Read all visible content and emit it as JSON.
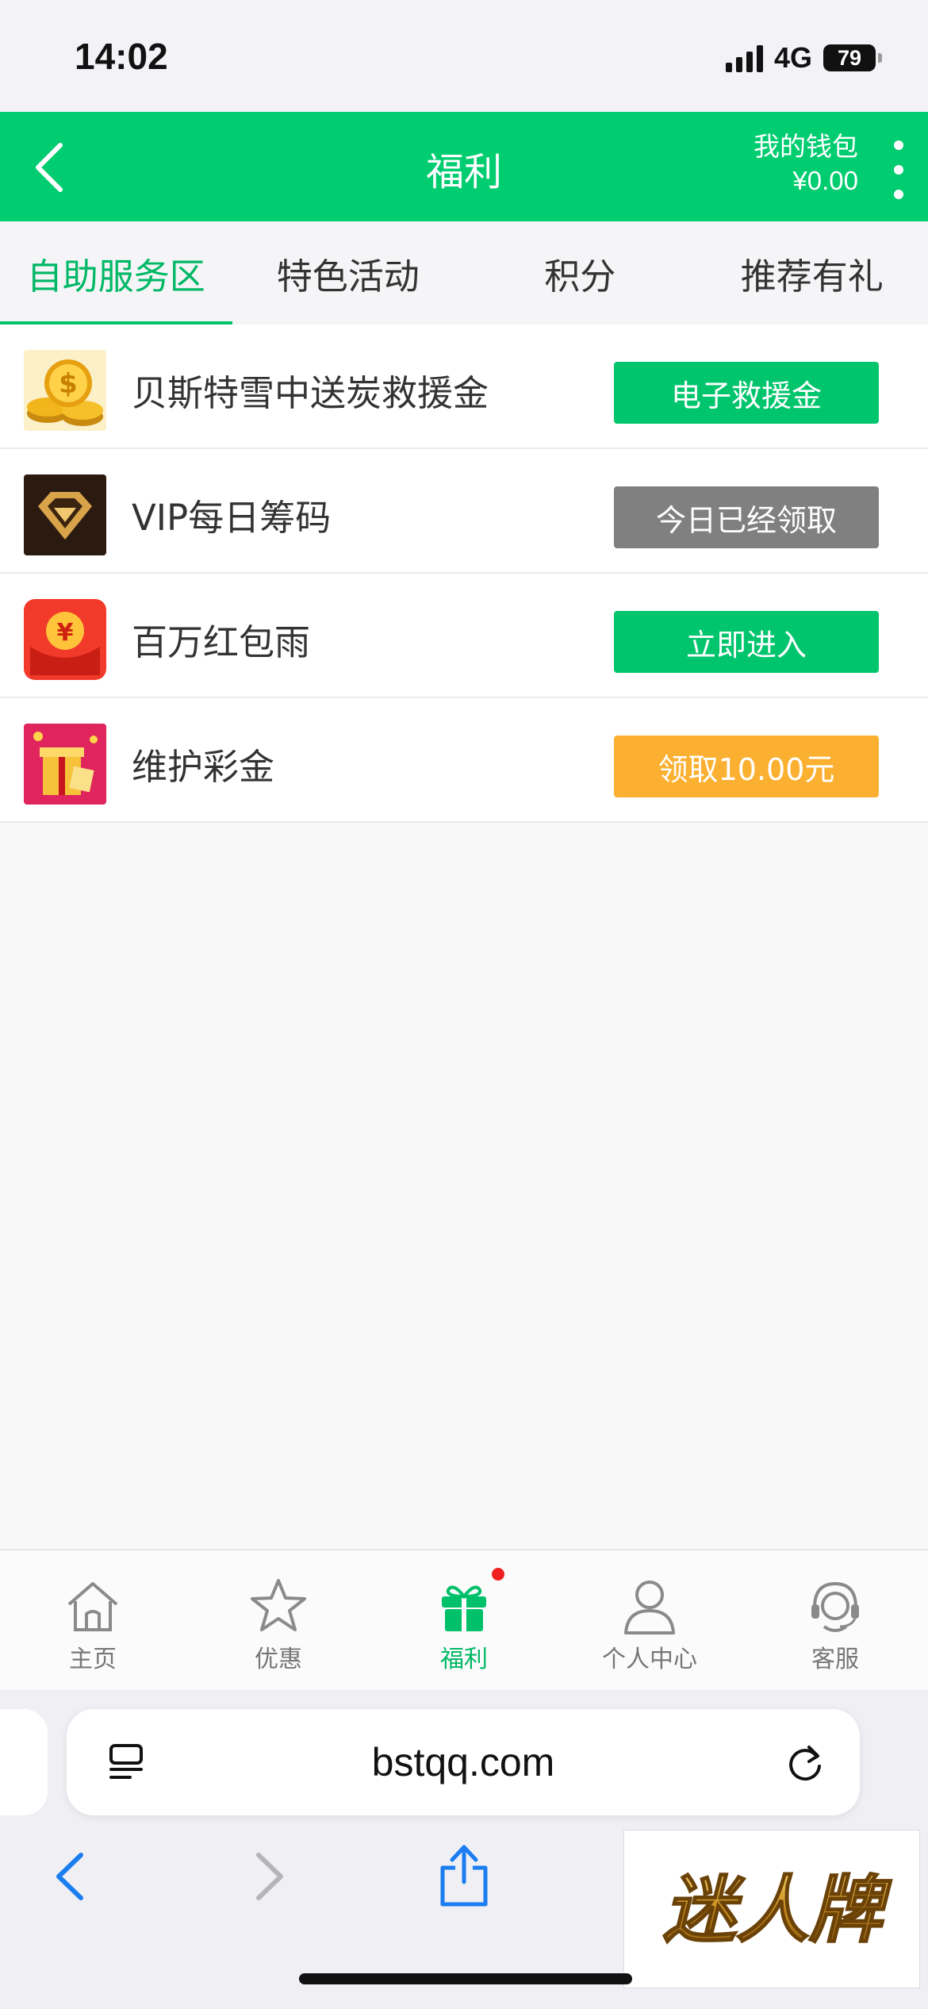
{
  "status_bar": {
    "time": "14:02",
    "network": "4G",
    "battery": "79"
  },
  "header": {
    "title": "福利",
    "wallet_label": "我的钱包",
    "wallet_amount": "¥0.00"
  },
  "tabs": [
    {
      "label": "自助服务区",
      "active": true
    },
    {
      "label": "特色活动",
      "active": false
    },
    {
      "label": "积分",
      "active": false
    },
    {
      "label": "推荐有礼",
      "active": false
    }
  ],
  "list": [
    {
      "label": "贝斯特雪中送炭救援金",
      "button": "电子救援金",
      "button_color": "#00c56c",
      "icon": "gold-coins-icon"
    },
    {
      "label": "VIP每日筹码",
      "button": "今日已经领取",
      "button_color": "#808080",
      "icon": "vip-diamond-icon"
    },
    {
      "label": "百万红包雨",
      "button": "立即进入",
      "button_color": "#00c56c",
      "icon": "red-envelope-icon"
    },
    {
      "label": "维护彩金",
      "button": "领取10.00元",
      "button_color": "#fbb031",
      "icon": "gift-box-icon"
    }
  ],
  "bottom_nav": [
    {
      "label": "主页",
      "icon": "home-icon"
    },
    {
      "label": "优惠",
      "icon": "star-icon"
    },
    {
      "label": "福利",
      "icon": "gift-icon",
      "active": true
    },
    {
      "label": "个人中心",
      "icon": "user-icon"
    },
    {
      "label": "客服",
      "icon": "headset-icon"
    }
  ],
  "browser": {
    "url": "bstqq.com"
  },
  "watermark": {
    "text": "迷人牌"
  },
  "colors": {
    "brand_green": "#00cc70",
    "active_tab": "#00b865",
    "button_green": "#00c56c",
    "button_gray": "#808080",
    "button_orange": "#fbb031"
  }
}
